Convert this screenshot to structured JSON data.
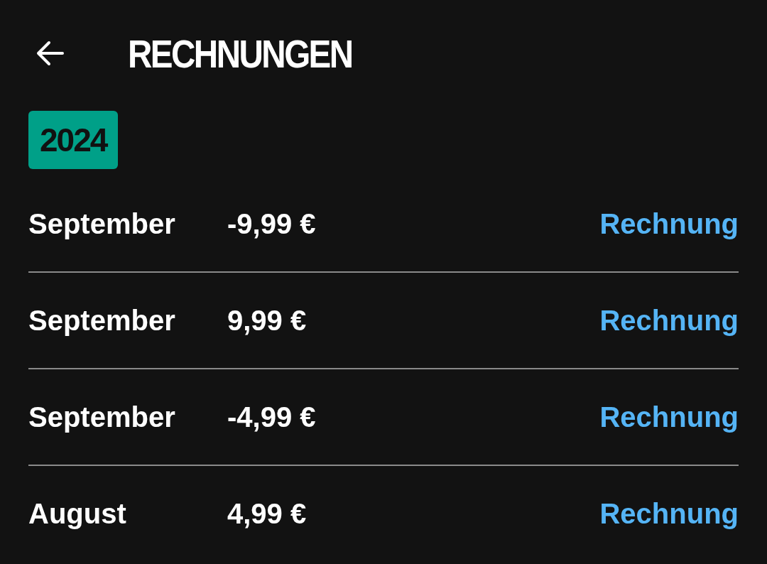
{
  "header": {
    "title": "RECHNUNGEN"
  },
  "year_badge": "2024",
  "invoices": [
    {
      "month": "September",
      "amount": "-9,99 €",
      "link": "Rechnung"
    },
    {
      "month": "September",
      "amount": "9,99 €",
      "link": "Rechnung"
    },
    {
      "month": "September",
      "amount": "-4,99 €",
      "link": "Rechnung"
    },
    {
      "month": "August",
      "amount": "4,99 €",
      "link": "Rechnung"
    }
  ]
}
